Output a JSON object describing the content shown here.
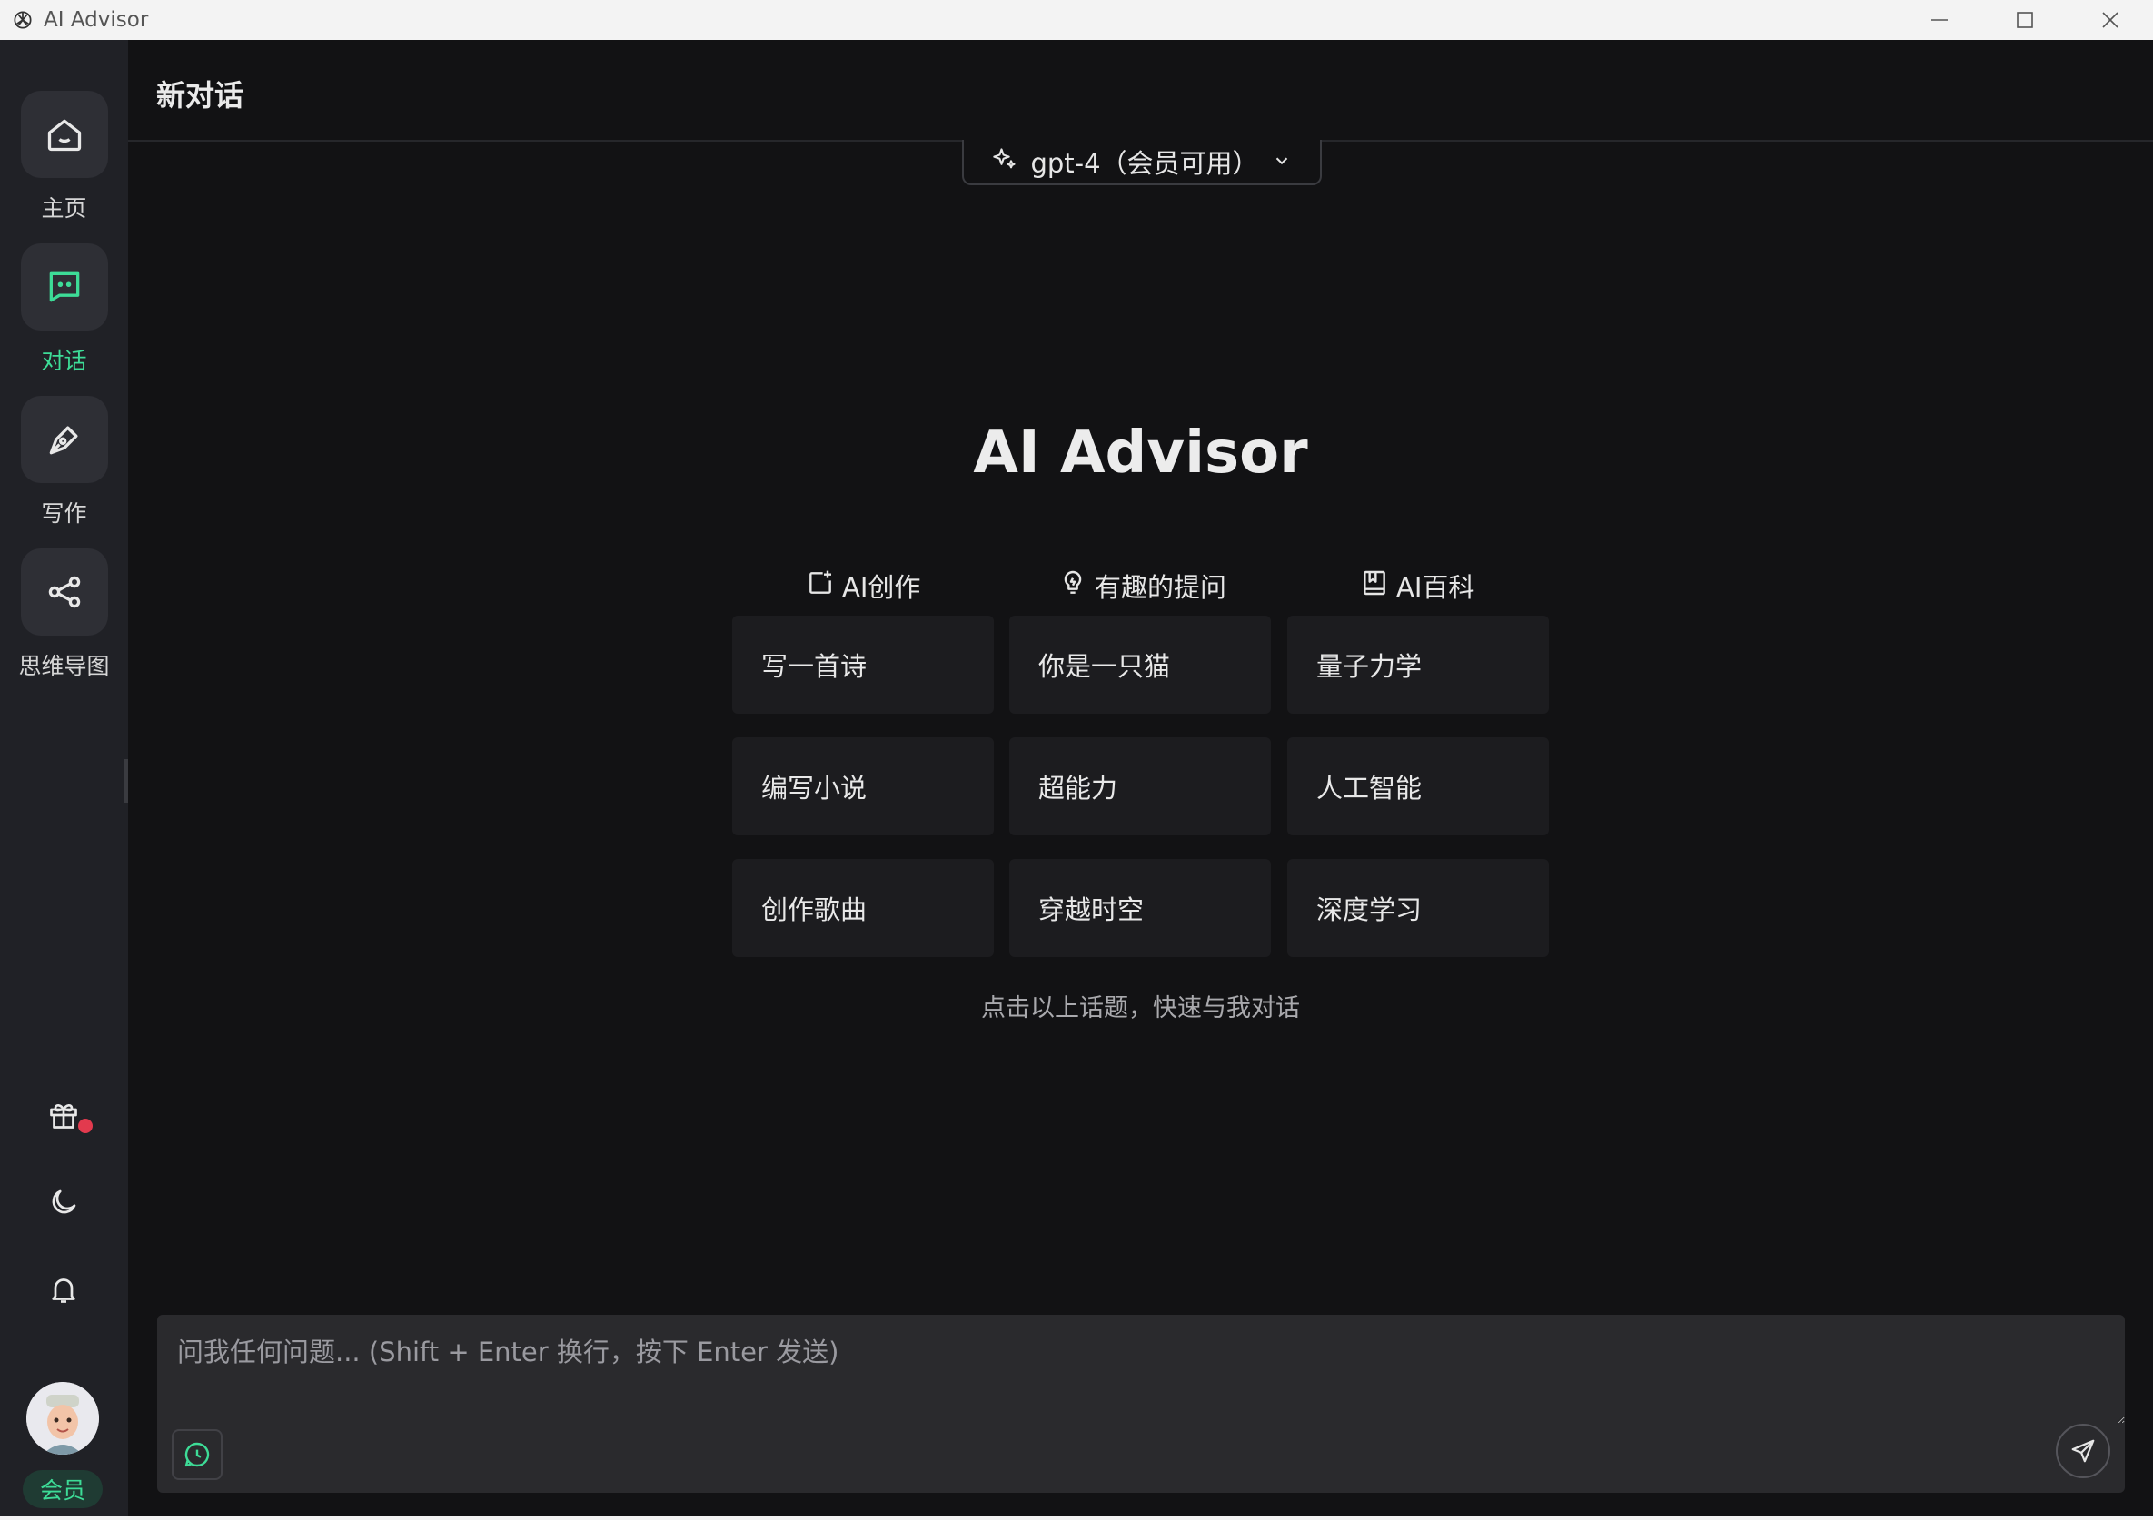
{
  "window": {
    "title": "AI Advisor"
  },
  "sidebar": {
    "items": [
      {
        "label": "主页",
        "icon": "home-icon"
      },
      {
        "label": "对话",
        "icon": "chat-icon",
        "active": true
      },
      {
        "label": "写作",
        "icon": "pen-icon"
      },
      {
        "label": "思维导图",
        "icon": "mindmap-icon"
      }
    ],
    "bottom_icons": [
      "gift-icon",
      "moon-icon",
      "bell-icon"
    ],
    "member_badge": "会员"
  },
  "header": {
    "title": "新对话"
  },
  "model_selector": {
    "value": "gpt-4（会员可用）"
  },
  "hero": {
    "title": "AI Advisor"
  },
  "categories": [
    {
      "label": "AI创作",
      "icon": "edit-square-icon"
    },
    {
      "label": "有趣的提问",
      "icon": "lightbulb-icon"
    },
    {
      "label": "AI百科",
      "icon": "book-icon"
    }
  ],
  "topics": [
    [
      "写一首诗",
      "你是一只猫",
      "量子力学"
    ],
    [
      "编写小说",
      "超能力",
      "人工智能"
    ],
    [
      "创作歌曲",
      "穿越时空",
      "深度学习"
    ]
  ],
  "hint": "点击以上话题，快速与我对话",
  "composer": {
    "placeholder": "问我任何问题... (Shift + Enter 换行，按下 Enter 发送)",
    "value": ""
  },
  "colors": {
    "accent": "#3ddc97",
    "background": "#121214",
    "sidebar": "#202126",
    "card": "#1c1c1f",
    "badge": "#e23a4e"
  }
}
